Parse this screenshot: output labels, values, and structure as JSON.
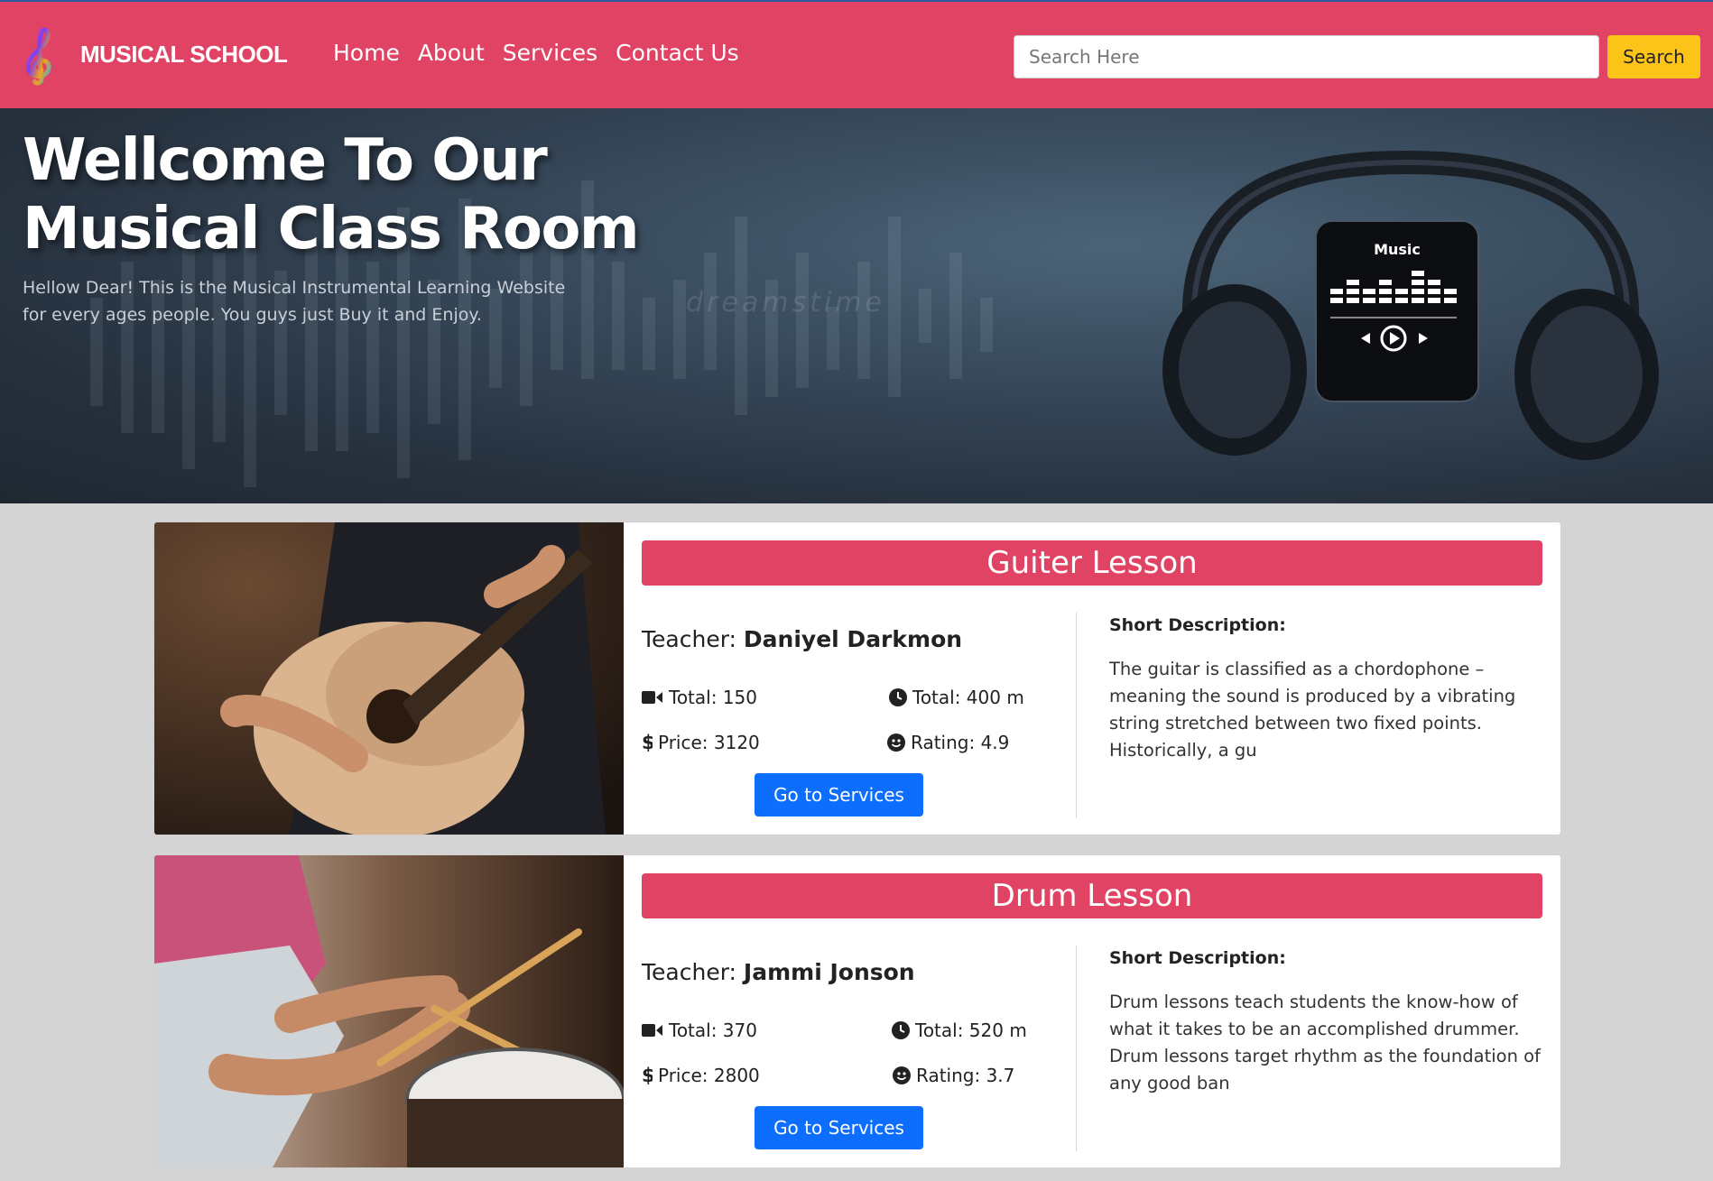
{
  "brand": {
    "name": "MUSICAL SCHOOL",
    "logo": "treble-clef-icon"
  },
  "nav": {
    "items": [
      "Home",
      "About",
      "Services",
      "Contact Us"
    ]
  },
  "search": {
    "placeholder": "Search Here",
    "button_label": "Search"
  },
  "hero": {
    "title_line1": "Wellcome To Our",
    "title_line2": "Musical Class Room",
    "subtitle_line1": "Hellow Dear! This is the Musical Instrumental Learning Website",
    "subtitle_line2": "for every ages people. You guys just Buy it and Enjoy.",
    "watermark": "dreamstime",
    "phone_label": "Music"
  },
  "lessons": [
    {
      "title": "Guiter Lesson",
      "teacher_prefix": "Teacher:",
      "teacher_name": "Daniyel Darkmon",
      "total_videos": "Total: 150",
      "total_time": "Total: 400 m",
      "price": "Price: 3120",
      "rating": "Rating: 4.9",
      "button_label": "Go to Services",
      "desc_label": "Short Description:",
      "description": "The guitar is classified as a chordophone – meaning the sound is produced by a vibrating string stretched between two fixed points. Historically, a gu"
    },
    {
      "title": "Drum Lesson",
      "teacher_prefix": "Teacher:",
      "teacher_name": "Jammi Jonson",
      "total_videos": "Total: 370",
      "total_time": "Total: 520 m",
      "price": "Price: 2800",
      "rating": "Rating: 3.7",
      "button_label": "Go to Services",
      "desc_label": "Short Description:",
      "description": "Drum lessons teach students the know-how of what it takes to be an accomplished drummer. Drum lessons target rhythm as the foundation of any good ban"
    }
  ],
  "colors": {
    "primary": "#e04363",
    "accent": "#fcc419",
    "button": "#0d6efd"
  }
}
